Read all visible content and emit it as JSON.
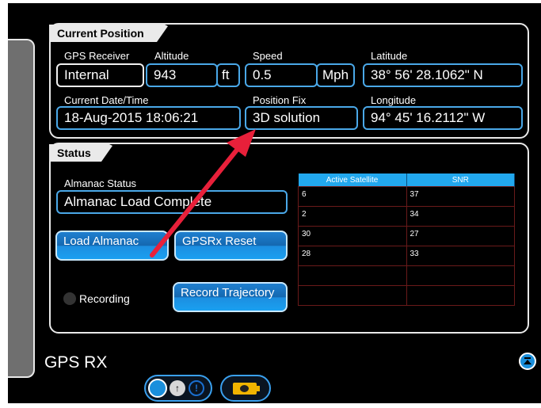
{
  "current_position": {
    "tab_title": "Current Position",
    "gps_receiver_label": "GPS Receiver",
    "gps_receiver_value": "Internal",
    "altitude_label": "Altitude",
    "altitude_value": "943",
    "altitude_unit": "ft",
    "speed_label": "Speed",
    "speed_value": "0.5",
    "speed_unit": "Mph",
    "latitude_label": "Latitude",
    "latitude_value": "38° 56' 28.1062\" N",
    "datetime_label": "Current Date/Time",
    "datetime_value": "18-Aug-2015 18:06:21",
    "position_fix_label": "Position Fix",
    "position_fix_value": "3D solution",
    "longitude_label": "Longitude",
    "longitude_value": "94° 45' 16.2112\" W"
  },
  "status": {
    "tab_title": "Status",
    "almanac_label": "Almanac Status",
    "almanac_value": "Almanac Load Complete",
    "load_almanac_button": "Load Almanac",
    "gpsrx_reset_button": "GPSRx Reset",
    "recording_label": "Recording",
    "record_trajectory_button": "Record Trajectory",
    "table": {
      "headers": [
        "Active Satellite",
        "SNR"
      ],
      "rows": [
        [
          "6",
          "37"
        ],
        [
          "2",
          "34"
        ],
        [
          "30",
          "27"
        ],
        [
          "28",
          "33"
        ],
        [
          "",
          ""
        ],
        [
          "",
          ""
        ]
      ]
    }
  },
  "footer": {
    "title": "GPS RX"
  },
  "colors": {
    "accent": "#22a8ee",
    "arrow": "#e8203a"
  },
  "icons": [
    "scroll-up-icon",
    "toggle-icon",
    "info-icon",
    "battery-icon"
  ]
}
